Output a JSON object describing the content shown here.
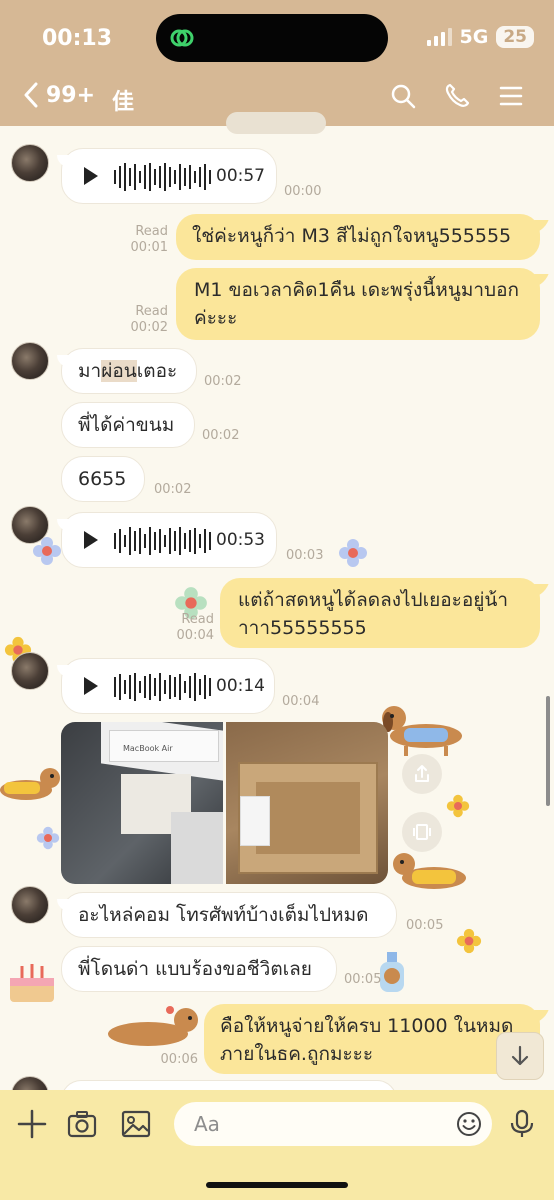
{
  "status": {
    "time": "00:13",
    "network": "5G",
    "battery": "25"
  },
  "nav": {
    "back_count": "99+",
    "title": "佳"
  },
  "messages": [
    {
      "id": "v1",
      "kind": "voice",
      "side": "in",
      "duration": "00:57",
      "time": "00:00"
    },
    {
      "id": "o1",
      "kind": "text",
      "side": "out",
      "text": "ใช่ค่ะหนูก็ว่า M3 สีไม่ถูกใจหนู555555",
      "read": "Read",
      "time": "00:01"
    },
    {
      "id": "o2",
      "kind": "text",
      "side": "out",
      "lines": [
        "M1 ขอเวลาคิด1คืน เดะพรุ่งนี้หนูมาบอก",
        "ค่ะะะ"
      ],
      "read": "Read",
      "time": "00:02"
    },
    {
      "id": "i1",
      "kind": "text",
      "side": "in",
      "text_a": "มา",
      "text_b": "ผ่อน",
      "text_c": "เตอะ",
      "time": "00:02"
    },
    {
      "id": "i2",
      "kind": "text",
      "side": "in",
      "text": "พี่ได้ค่าขนม",
      "time": "00:02"
    },
    {
      "id": "i3",
      "kind": "text",
      "side": "in",
      "text": "6655",
      "time": "00:02"
    },
    {
      "id": "v2",
      "kind": "voice",
      "side": "in",
      "duration": "00:53",
      "time": "00:03"
    },
    {
      "id": "o3",
      "kind": "text",
      "side": "out",
      "lines": [
        "แต่ถ้าสดหนูได้ลดลงไปเยอะอยู่น้า",
        "าาา55555555"
      ],
      "read": "Read",
      "time": "00:04"
    },
    {
      "id": "v3",
      "kind": "voice",
      "side": "in",
      "duration": "00:14",
      "time": "00:04"
    },
    {
      "id": "ph",
      "kind": "photos",
      "side": "in",
      "photo1_caption": "MacBook Air"
    },
    {
      "id": "i4",
      "kind": "text",
      "side": "in",
      "text": "อะไหล่คอม โทรศัพท์บ้างเต็มไปหมด",
      "time": "00:05"
    },
    {
      "id": "i5",
      "kind": "text",
      "side": "in",
      "text": "พี่โดนด่า แบบร้องขอชีวิตเลย",
      "time": "00:05"
    },
    {
      "id": "o4",
      "kind": "text",
      "side": "out",
      "lines": [
        "คือให้หนูจ่ายให้ครบ 11000 ในหมด",
        "ภายในธค.ถูกมะะะ"
      ],
      "time": "00:06"
    }
  ],
  "input": {
    "placeholder": "Aa"
  },
  "icons": {
    "back": "chevron-left-icon",
    "search": "search-icon",
    "call": "phone-icon",
    "menu": "menu-icon",
    "share": "share-icon",
    "save": "save-icon",
    "scroll_down": "chevron-down-icon",
    "plus": "plus-icon",
    "camera": "camera-icon",
    "image": "image-icon",
    "emoji": "emoji-icon",
    "mic": "mic-icon"
  },
  "colors": {
    "header": "#d6b895",
    "outgoing": "#fbe69a",
    "incoming": "#ffffff",
    "background": "#fbf8ee",
    "toolbar": "#f8e9a6"
  }
}
